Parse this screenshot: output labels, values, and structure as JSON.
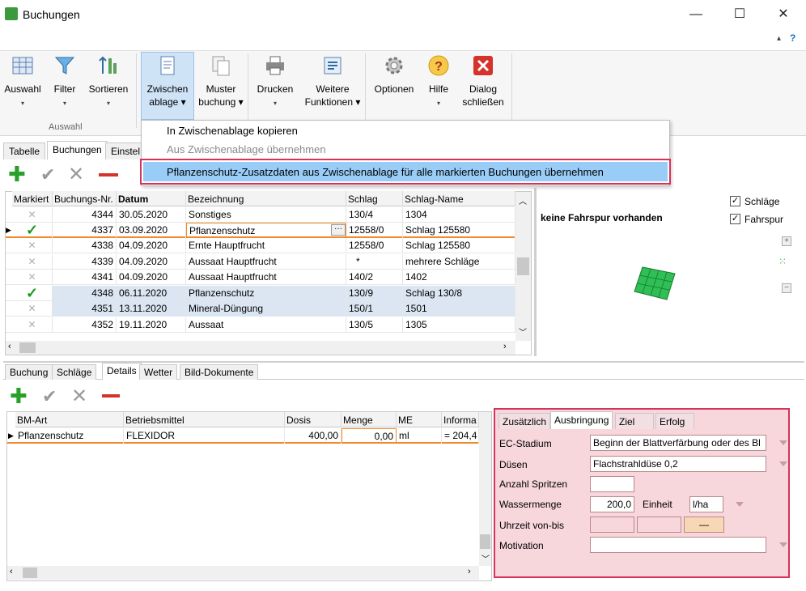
{
  "window": {
    "title": "Buchungen",
    "minimize": "—",
    "maximize": "☐",
    "close": "✕"
  },
  "ribbon": {
    "buttons": [
      {
        "l1": "Auswahl",
        "l2": "▾"
      },
      {
        "l1": "Filter",
        "l2": "▾"
      },
      {
        "l1": "Sortieren",
        "l2": "▾"
      },
      {
        "l1": "Zwischen",
        "l2": "ablage ▾"
      },
      {
        "l1": "Muster",
        "l2": "buchung ▾"
      },
      {
        "l1": "Drucken",
        "l2": "▾"
      },
      {
        "l1": "Weitere",
        "l2": "Funktionen ▾"
      },
      {
        "l1": "Optionen",
        "l2": ""
      },
      {
        "l1": "Hilfe",
        "l2": "▾"
      },
      {
        "l1": "Dialog",
        "l2": "schließen"
      }
    ],
    "group_label": "Auswahl"
  },
  "menu": {
    "items": [
      "In Zwischenablage kopieren",
      "Aus Zwischenablage übernehmen",
      "Pflanzenschutz-Zusatzdaten aus Zwischenablage für alle markierten Buchungen übernehmen"
    ]
  },
  "tabs": {
    "items": [
      "Tabelle",
      "Buchungen",
      "Einstel"
    ]
  },
  "grid": {
    "headers": [
      "Markiert",
      "Buchungs-Nr.",
      "Datum",
      "Bezeichnung",
      "Schlag",
      "Schlag-Name"
    ],
    "rows": [
      {
        "nr": "4344",
        "datum": "30.05.2020",
        "bez": "Sonstiges",
        "schlag": "130/4",
        "name": "1304"
      },
      {
        "nr": "4337",
        "datum": "03.09.2020",
        "bez": "Pflanzenschutz",
        "schlag": "12558/0",
        "name": "Schlag 125580"
      },
      {
        "nr": "4338",
        "datum": "04.09.2020",
        "bez": "Ernte Hauptfrucht",
        "schlag": "12558/0",
        "name": "Schlag 125580"
      },
      {
        "nr": "4339",
        "datum": "04.09.2020",
        "bez": "Aussaat Hauptfrucht",
        "schlag": "*",
        "name": "mehrere Schläge"
      },
      {
        "nr": "4341",
        "datum": "04.09.2020",
        "bez": "Aussaat Hauptfrucht",
        "schlag": "140/2",
        "name": "1402"
      },
      {
        "nr": "4348",
        "datum": "06.11.2020",
        "bez": "Pflanzenschutz",
        "schlag": "130/9",
        "name": "Schlag 130/8"
      },
      {
        "nr": "4351",
        "datum": "13.11.2020",
        "bez": "Mineral-Düngung",
        "schlag": "150/1",
        "name": "1501"
      },
      {
        "nr": "4352",
        "datum": "19.11.2020",
        "bez": "Aussaat",
        "schlag": "130/5",
        "name": "1305"
      }
    ],
    "ellipsis": "···"
  },
  "map": {
    "message": "keine Fahrspur vorhanden",
    "cb1": "Schläge",
    "cb2": "Fahrspur"
  },
  "lowertabs": {
    "items": [
      "Buchung",
      "Schläge",
      "Details",
      "Wetter",
      "Bild-Dokumente"
    ]
  },
  "lowergrid": {
    "headers": [
      "BM-Art",
      "Betriebsmittel",
      "Dosis",
      "Menge",
      "ME",
      "Informa"
    ],
    "row": {
      "art": "Pflanzenschutz",
      "bm": "FLEXIDOR",
      "dosis": "400,00",
      "menge": "0,00",
      "me": "ml",
      "info": "= 204,4"
    }
  },
  "detail": {
    "tabs": [
      "Zusätzlich",
      "Ausbringung",
      "Ziel",
      "Erfolg"
    ],
    "ec_label": "EC-Stadium",
    "ec_value": "Beginn der Blattverfärbung oder des Bl",
    "duesen_label": "Düsen",
    "duesen_value": "Flachstrahldüse 0,2",
    "spritzen_label": "Anzahl Spritzen",
    "wasser_label": "Wassermenge",
    "wasser_value": "200,0",
    "einheit_label": "Einheit",
    "einheit_value": "l/ha",
    "uhrzeit_label": "Uhrzeit von-bis",
    "uhrzeit_sep": "—",
    "motivation_label": "Motivation"
  }
}
